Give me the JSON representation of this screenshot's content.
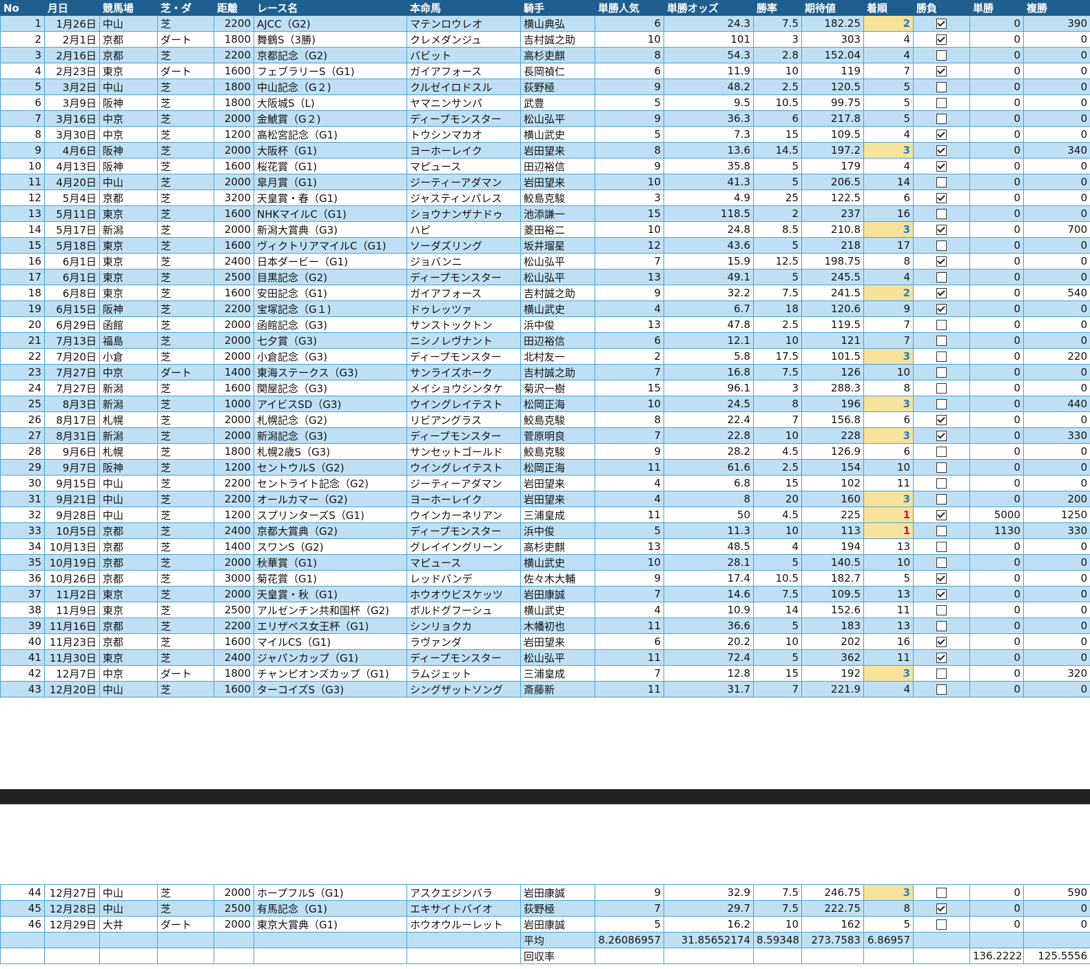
{
  "headers": [
    "No",
    "月日",
    "競馬場",
    "芝・ダ",
    "距離",
    "レース名",
    "本命馬",
    "騎手",
    "単勝人気",
    "単勝オッズ",
    "勝率",
    "期待値",
    "着順",
    "勝負",
    "単勝",
    "複勝"
  ],
  "rows": [
    [
      "1",
      "1月26日",
      "中山",
      "芝",
      "2200",
      "AJCC（G2)",
      "マテンロウレオ",
      "横山典弘",
      "6",
      "24.3",
      "7.5",
      "182.25",
      "2",
      true,
      "0",
      "390"
    ],
    [
      "2",
      "2月1日",
      "京都",
      "ダート",
      "1800",
      "舞鶴S（3勝)",
      "クレメダンジュ",
      "吉村誠之助",
      "10",
      "101",
      "3",
      "303",
      "4",
      true,
      "0",
      "0"
    ],
    [
      "3",
      "2月16日",
      "京都",
      "芝",
      "2200",
      "京都記念（G2)",
      "バビット",
      "高杉吏麒",
      "8",
      "54.3",
      "2.8",
      "152.04",
      "4",
      false,
      "0",
      "0"
    ],
    [
      "4",
      "2月23日",
      "東京",
      "ダート",
      "1600",
      "フェブラリーS（G1)",
      "ガイアフォース",
      "長岡禎仁",
      "6",
      "11.9",
      "10",
      "119",
      "7",
      true,
      "0",
      "0"
    ],
    [
      "5",
      "3月2日",
      "中山",
      "芝",
      "1800",
      "中山記念（G２)",
      "クルゼイロドスル",
      "荻野極",
      "9",
      "48.2",
      "2.5",
      "120.5",
      "5",
      false,
      "0",
      "0"
    ],
    [
      "6",
      "3月9日",
      "阪神",
      "芝",
      "1800",
      "大阪城S（L)",
      "ヤマニンサンパ",
      "武豊",
      "5",
      "9.5",
      "10.5",
      "99.75",
      "5",
      false,
      "0",
      "0"
    ],
    [
      "7",
      "3月16日",
      "中京",
      "芝",
      "2000",
      "金鯱賞（G２)",
      "ディープモンスター",
      "松山弘平",
      "9",
      "36.3",
      "6",
      "217.8",
      "5",
      false,
      "0",
      "0"
    ],
    [
      "8",
      "3月30日",
      "中京",
      "芝",
      "1200",
      "高松宮記念（G1)",
      "トウシンマカオ",
      "横山武史",
      "5",
      "7.3",
      "15",
      "109.5",
      "4",
      true,
      "0",
      "0"
    ],
    [
      "9",
      "4月6日",
      "阪神",
      "芝",
      "2000",
      "大阪杯（G1)",
      "ヨーホーレイク",
      "岩田望来",
      "8",
      "13.6",
      "14.5",
      "197.2",
      "3",
      true,
      "0",
      "340"
    ],
    [
      "10",
      "4月13日",
      "阪神",
      "芝",
      "1600",
      "桜花賞（G1)",
      "マピュース",
      "田辺裕信",
      "9",
      "35.8",
      "5",
      "179",
      "4",
      true,
      "0",
      "0"
    ],
    [
      "11",
      "4月20日",
      "中山",
      "芝",
      "2000",
      "皐月賞（G1)",
      "ジーティーアダマン",
      "岩田望来",
      "10",
      "41.3",
      "5",
      "206.5",
      "14",
      false,
      "0",
      "0"
    ],
    [
      "12",
      "5月4日",
      "京都",
      "芝",
      "3200",
      "天皇賞・春（G1)",
      "ジャスティンパレス",
      "鮫島克駿",
      "3",
      "4.9",
      "25",
      "122.5",
      "6",
      true,
      "0",
      "0"
    ],
    [
      "13",
      "5月11日",
      "東京",
      "芝",
      "1600",
      "NHKマイルC（G1)",
      "ショウナンザナドゥ",
      "池添謙一",
      "15",
      "118.5",
      "2",
      "237",
      "16",
      false,
      "0",
      "0"
    ],
    [
      "14",
      "5月17日",
      "新潟",
      "芝",
      "2000",
      "新潟大賞典（G3)",
      "ハピ",
      "菱田裕二",
      "10",
      "24.8",
      "8.5",
      "210.8",
      "3",
      true,
      "0",
      "700"
    ],
    [
      "15",
      "5月18日",
      "東京",
      "芝",
      "1600",
      "ヴィクトリアマイルC（G1)",
      "ソーダズリング",
      "坂井瑠星",
      "12",
      "43.6",
      "5",
      "218",
      "17",
      false,
      "0",
      "0"
    ],
    [
      "16",
      "6月1日",
      "東京",
      "芝",
      "2400",
      "日本ダービー（G1)",
      "ジョバンニ",
      "松山弘平",
      "7",
      "15.9",
      "12.5",
      "198.75",
      "8",
      true,
      "0",
      "0"
    ],
    [
      "17",
      "6月1日",
      "東京",
      "芝",
      "2500",
      "目黒記念（G2)",
      "ディープモンスター",
      "松山弘平",
      "13",
      "49.1",
      "5",
      "245.5",
      "4",
      false,
      "0",
      "0"
    ],
    [
      "18",
      "6月8日",
      "東京",
      "芝",
      "1600",
      "安田記念（G1)",
      "ガイアフォース",
      "吉村誠之助",
      "9",
      "32.2",
      "7.5",
      "241.5",
      "2",
      true,
      "0",
      "540"
    ],
    [
      "19",
      "6月15日",
      "阪神",
      "芝",
      "2200",
      "宝塚記念（G１)",
      "ドゥレッツァ",
      "横山武史",
      "4",
      "6.7",
      "18",
      "120.6",
      "9",
      true,
      "0",
      "0"
    ],
    [
      "20",
      "6月29日",
      "函館",
      "芝",
      "2000",
      "函館記念（G3)",
      "サンストックトン",
      "浜中俊",
      "13",
      "47.8",
      "2.5",
      "119.5",
      "7",
      false,
      "0",
      "0"
    ],
    [
      "21",
      "7月13日",
      "福島",
      "芝",
      "2000",
      "七夕賞（G3)",
      "ニシノレヴナント",
      "田辺裕信",
      "6",
      "12.1",
      "10",
      "121",
      "7",
      false,
      "0",
      "0"
    ],
    [
      "22",
      "7月20日",
      "小倉",
      "芝",
      "2000",
      "小倉記念（G3)",
      "ディープモンスター",
      "北村友一",
      "2",
      "5.8",
      "17.5",
      "101.5",
      "3",
      false,
      "0",
      "220"
    ],
    [
      "23",
      "7月27日",
      "中京",
      "ダート",
      "1400",
      "東海ステークス（G3)",
      "サンライズホーク",
      "吉村誠之助",
      "7",
      "16.8",
      "7.5",
      "126",
      "10",
      false,
      "0",
      "0"
    ],
    [
      "24",
      "7月27日",
      "新潟",
      "芝",
      "1600",
      "関屋記念（G3)",
      "メイショウシンタケ",
      "菊沢一樹",
      "15",
      "96.1",
      "3",
      "288.3",
      "8",
      false,
      "0",
      "0"
    ],
    [
      "25",
      "8月3日",
      "新潟",
      "芝",
      "1000",
      "アイビスSD（G3)",
      "ウイングレイテスト",
      "松岡正海",
      "10",
      "24.5",
      "8",
      "196",
      "3",
      false,
      "0",
      "440"
    ],
    [
      "26",
      "8月17日",
      "札幌",
      "芝",
      "2000",
      "札幌記念（G2)",
      "リビアングラス",
      "鮫島克駿",
      "8",
      "22.4",
      "7",
      "156.8",
      "6",
      true,
      "0",
      "0"
    ],
    [
      "27",
      "8月31日",
      "新潟",
      "芝",
      "2000",
      "新潟記念（G3)",
      "ディープモンスター",
      "菅原明良",
      "7",
      "22.8",
      "10",
      "228",
      "3",
      true,
      "0",
      "330"
    ],
    [
      "28",
      "9月6日",
      "札幌",
      "芝",
      "1800",
      "札幌2歳S（G3)",
      "サンセットゴールド",
      "鮫島克駿",
      "9",
      "28.2",
      "4.5",
      "126.9",
      "6",
      false,
      "0",
      "0"
    ],
    [
      "29",
      "9月7日",
      "阪神",
      "芝",
      "1200",
      "セントウルS（G2)",
      "ウイングレイテスト",
      "松岡正海",
      "11",
      "61.6",
      "2.5",
      "154",
      "10",
      false,
      "0",
      "0"
    ],
    [
      "30",
      "9月15日",
      "中山",
      "芝",
      "2200",
      "セントライト記念（G2)",
      "ジーティーアダマン",
      "岩田望来",
      "4",
      "6.8",
      "15",
      "102",
      "11",
      false,
      "0",
      "0"
    ],
    [
      "31",
      "9月21日",
      "中山",
      "芝",
      "2200",
      "オールカマー（G2)",
      "ヨーホーレイク",
      "岩田望来",
      "4",
      "8",
      "20",
      "160",
      "3",
      false,
      "0",
      "200"
    ],
    [
      "32",
      "9月28日",
      "中山",
      "芝",
      "1200",
      "スプリンターズS（G1)",
      "ウインカーネリアン",
      "三浦皇成",
      "11",
      "50",
      "4.5",
      "225",
      "1",
      true,
      "5000",
      "1250"
    ],
    [
      "33",
      "10月5日",
      "京都",
      "芝",
      "2400",
      "京都大賞典（G2)",
      "ディープモンスター",
      "浜中俊",
      "5",
      "11.3",
      "10",
      "113",
      "1",
      false,
      "1130",
      "330"
    ],
    [
      "34",
      "10月13日",
      "京都",
      "芝",
      "1400",
      "スワンS（G2)",
      "グレイイングリーン",
      "高杉吏麒",
      "13",
      "48.5",
      "4",
      "194",
      "13",
      false,
      "0",
      "0"
    ],
    [
      "35",
      "10月19日",
      "京都",
      "芝",
      "2000",
      "秋華賞（G1)",
      "マピュース",
      "横山武史",
      "10",
      "28.1",
      "5",
      "140.5",
      "10",
      false,
      "0",
      "0"
    ],
    [
      "36",
      "10月26日",
      "京都",
      "芝",
      "3000",
      "菊花賞（G1)",
      "レッドバンデ",
      "佐々木大輔",
      "9",
      "17.4",
      "10.5",
      "182.7",
      "5",
      true,
      "0",
      "0"
    ],
    [
      "37",
      "11月2日",
      "東京",
      "芝",
      "2000",
      "天皇賞・秋（G1)",
      "ホウオウビスケッツ",
      "岩田康誠",
      "7",
      "14.6",
      "7.5",
      "109.5",
      "13",
      true,
      "0",
      "0"
    ],
    [
      "38",
      "11月9日",
      "東京",
      "芝",
      "2500",
      "アルゼンチン共和国杯（G2)",
      "ボルドグフーシュ",
      "横山武史",
      "4",
      "10.9",
      "14",
      "152.6",
      "11",
      false,
      "0",
      "0"
    ],
    [
      "39",
      "11月16日",
      "京都",
      "芝",
      "2200",
      "エリザベス女王杯（G1)",
      "シンリョクカ",
      "木幡初也",
      "11",
      "36.6",
      "5",
      "183",
      "13",
      false,
      "0",
      "0"
    ],
    [
      "40",
      "11月23日",
      "京都",
      "芝",
      "1600",
      "マイルCS（G1)",
      "ラヴァンダ",
      "岩田望来",
      "6",
      "20.2",
      "10",
      "202",
      "16",
      true,
      "0",
      "0"
    ],
    [
      "41",
      "11月30日",
      "東京",
      "芝",
      "2400",
      "ジャパンカップ（G1)",
      "ディープモンスター",
      "松山弘平",
      "11",
      "72.4",
      "5",
      "362",
      "11",
      true,
      "0",
      "0"
    ],
    [
      "42",
      "12月7日",
      "中京",
      "ダート",
      "1800",
      "チャンピオンズカップ（G1)",
      "ラムジェット",
      "三浦皇成",
      "7",
      "12.8",
      "15",
      "192",
      "3",
      false,
      "0",
      "320"
    ],
    [
      "43",
      "12月20日",
      "中山",
      "芝",
      "1600",
      "ターコイズS（G3)",
      "シングザットソング",
      "斎藤新",
      "11",
      "31.7",
      "7",
      "221.9",
      "4",
      false,
      "0",
      "0"
    ]
  ],
  "rows2": [
    [
      "44",
      "12月27日",
      "中山",
      "芝",
      "2000",
      "ホープフルS（G1)",
      "アスクエジンバラ",
      "岩田康誠",
      "9",
      "32.9",
      "7.5",
      "246.75",
      "3",
      false,
      "0",
      "590"
    ],
    [
      "45",
      "12月28日",
      "中山",
      "芝",
      "2500",
      "有馬記念（G1)",
      "エキサイトバイオ",
      "荻野極",
      "7",
      "29.7",
      "7.5",
      "222.75",
      "8",
      true,
      "0",
      "0"
    ],
    [
      "46",
      "12月29日",
      "大井",
      "ダート",
      "2000",
      "東京大賞典（G1)",
      "ホウオウルーレット",
      "岩田康誠",
      "5",
      "16.2",
      "10",
      "162",
      "5",
      false,
      "0",
      "0"
    ]
  ],
  "summary": {
    "avg_label": "平均",
    "avg_values": [
      "8.26086957",
      "31.85652174",
      "8.59348",
      "273.7583",
      "6.86957"
    ],
    "ret_label": "回収率",
    "ret_values": [
      "136.2222",
      "125.5556"
    ]
  },
  "colors": {
    "header_bg": "#1f5f8f",
    "row_band": "#bfe0f4",
    "highlight": "#f7e39a"
  }
}
